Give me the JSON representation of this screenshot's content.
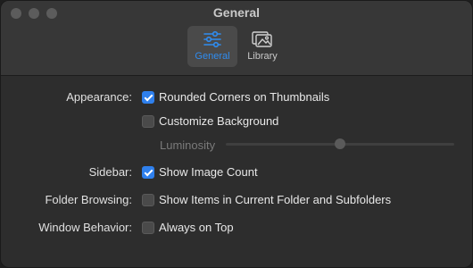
{
  "window": {
    "title": "General"
  },
  "toolbar": {
    "tabs": [
      {
        "label": "General",
        "icon": "sliders-icon",
        "selected": true
      },
      {
        "label": "Library",
        "icon": "photos-icon",
        "selected": false
      }
    ]
  },
  "settings": {
    "appearance": {
      "label": "Appearance:",
      "rounded_corners": {
        "label": "Rounded Corners on Thumbnails",
        "checked": true
      },
      "customize_background": {
        "label": "Customize Background",
        "checked": false
      },
      "luminosity": {
        "label": "Luminosity",
        "value": 0.5,
        "enabled": false
      }
    },
    "sidebar": {
      "label": "Sidebar:",
      "show_image_count": {
        "label": "Show Image Count",
        "checked": true
      }
    },
    "folder_browsing": {
      "label": "Folder Browsing:",
      "show_items": {
        "label": "Show Items in Current Folder and Subfolders",
        "checked": false
      }
    },
    "window_behavior": {
      "label": "Window Behavior:",
      "always_on_top": {
        "label": "Always on Top",
        "checked": false
      }
    }
  },
  "colors": {
    "accent": "#2f80ed",
    "background": "#2d2d2d",
    "titlebar": "#373737"
  }
}
